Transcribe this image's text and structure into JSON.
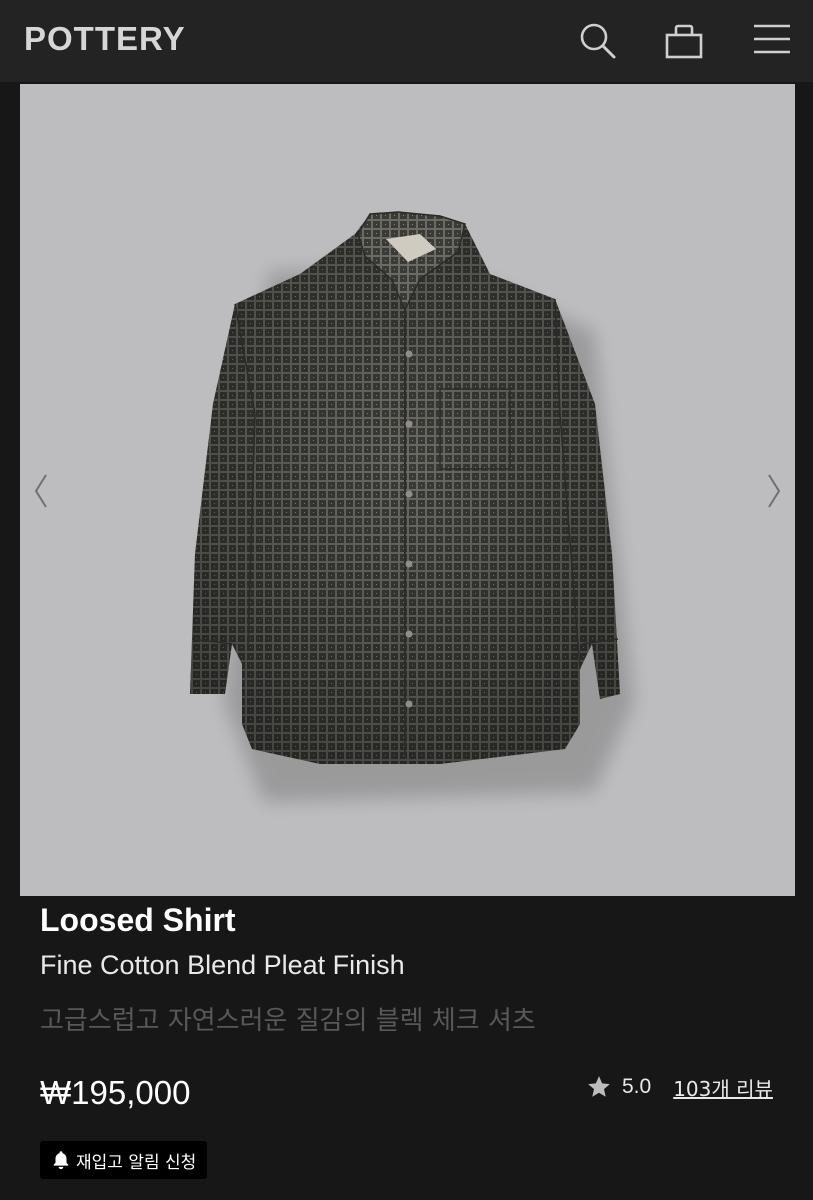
{
  "header": {
    "logo": "POTTERY",
    "icons": [
      "search-icon",
      "shopping-bag-icon",
      "hamburger-menu-icon"
    ]
  },
  "gallery": {
    "image_alt": "shirt-photo",
    "prev_icon": "chevron-left-icon",
    "next_icon": "chevron-right-icon"
  },
  "product": {
    "name": "Loosed Shirt",
    "subtitle": "Fine Cotton Blend Pleat Finish",
    "description": "고급스럽고 자연스러운 질감의 블렉 체크 셔츠",
    "price": "₩195,000",
    "rating": "5.0",
    "reviews_label": "103개 리뷰"
  },
  "restock": {
    "label": "재입고 알림 신청",
    "icon": "bell-icon"
  },
  "colors": {
    "background": "#171717",
    "header": "#232323",
    "hero_bg": "#bdbdbf",
    "shirt": "#3b3b38"
  }
}
